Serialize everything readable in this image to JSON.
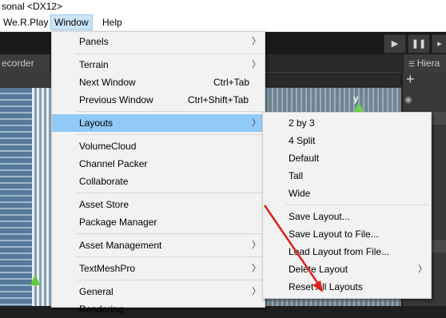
{
  "window_title": "sonal <DX12>",
  "menubar": {
    "items": [
      "We.R.Play",
      "Window",
      "Help"
    ]
  },
  "editor": {
    "recorder_tab": "ecorder",
    "hierarchy_tab": "Hiera",
    "hierarchy_add": "+",
    "gizmo_axis": "y"
  },
  "window_menu": [
    {
      "label": "Panels",
      "submenu": true
    },
    {
      "label": "Terrain",
      "submenu": true
    },
    {
      "label": "Next Window",
      "shortcut": "Ctrl+Tab"
    },
    {
      "label": "Previous Window",
      "shortcut": "Ctrl+Shift+Tab"
    },
    {
      "label": "Layouts",
      "submenu": true,
      "highlighted": true
    },
    {
      "label": "VolumeCloud"
    },
    {
      "label": "Channel Packer"
    },
    {
      "label": "Collaborate"
    },
    {
      "label": "Asset Store"
    },
    {
      "label": "Package Manager"
    },
    {
      "label": "Asset Management",
      "submenu": true
    },
    {
      "label": "TextMeshPro",
      "submenu": true
    },
    {
      "label": "General",
      "submenu": true
    },
    {
      "label": "Rendering"
    }
  ],
  "layouts_menu": [
    {
      "label": "2 by 3"
    },
    {
      "label": "4 Split"
    },
    {
      "label": "Default"
    },
    {
      "label": "Tall"
    },
    {
      "label": "Wide"
    },
    {
      "label": "Save Layout..."
    },
    {
      "label": "Save Layout to File..."
    },
    {
      "label": "Load Layout from File..."
    },
    {
      "label": "Delete Layout",
      "submenu": true
    },
    {
      "label": "Reset All Layouts"
    }
  ],
  "annotation": {
    "color": "#e0201c"
  },
  "colors": {
    "menu_bg": "#f2f2f2",
    "highlight": "#91c9f7",
    "editor_dark": "#1f1f1f"
  }
}
